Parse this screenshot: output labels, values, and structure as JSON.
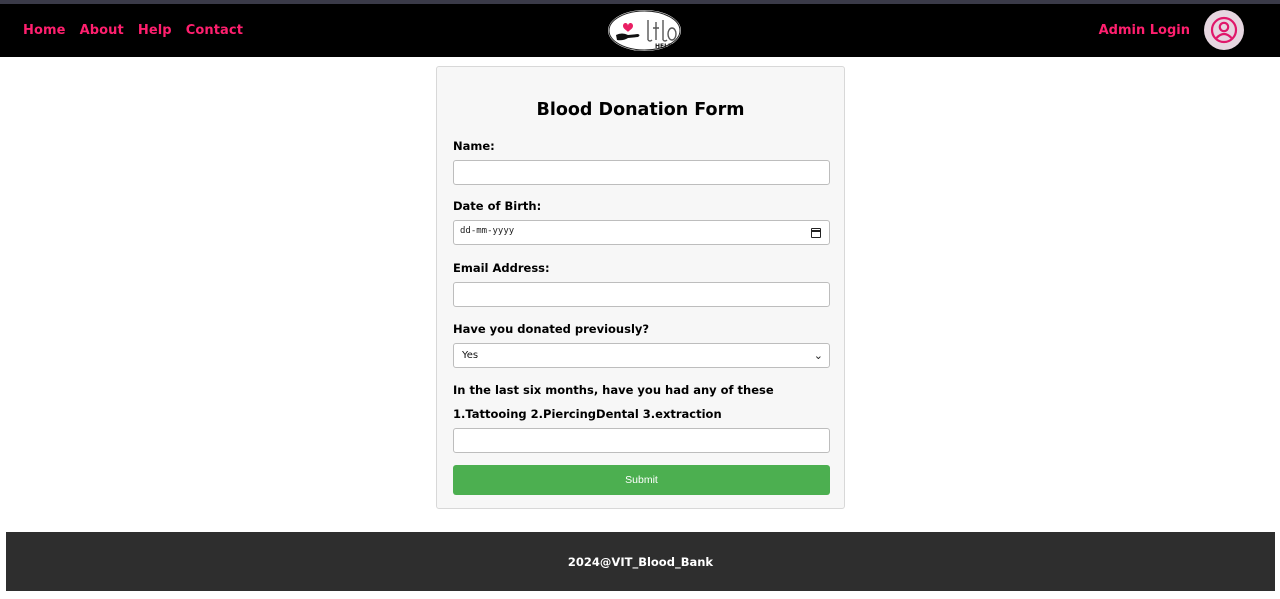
{
  "nav": {
    "links": [
      "Home",
      "About",
      "Help",
      "Contact"
    ],
    "admin_login": "Admin Login",
    "logo_text": "HELP",
    "accent_color": "#ff1f6e"
  },
  "form": {
    "title": "Blood Donation Form",
    "name_label": "Name:",
    "dob_label": "Date of Birth:",
    "dob_placeholder": "dd-mm-yyyy",
    "email_label": "Email Address:",
    "donated_label": "Have you donated previously?",
    "donated_value": "Yes",
    "six_months_label": "In the last six months, have you had any of these",
    "conditions_label": "1.Tattooing 2.PiercingDental 3.extraction",
    "submit_label": "Submit",
    "submit_color": "#4caf50"
  },
  "footer": {
    "text": "2024@VIT_Blood_Bank"
  },
  "icons": {
    "logo": "hand-holding-heart-logo",
    "avatar": "user-circle-icon",
    "calendar": "calendar-icon",
    "select": "chevron-down-icon"
  }
}
